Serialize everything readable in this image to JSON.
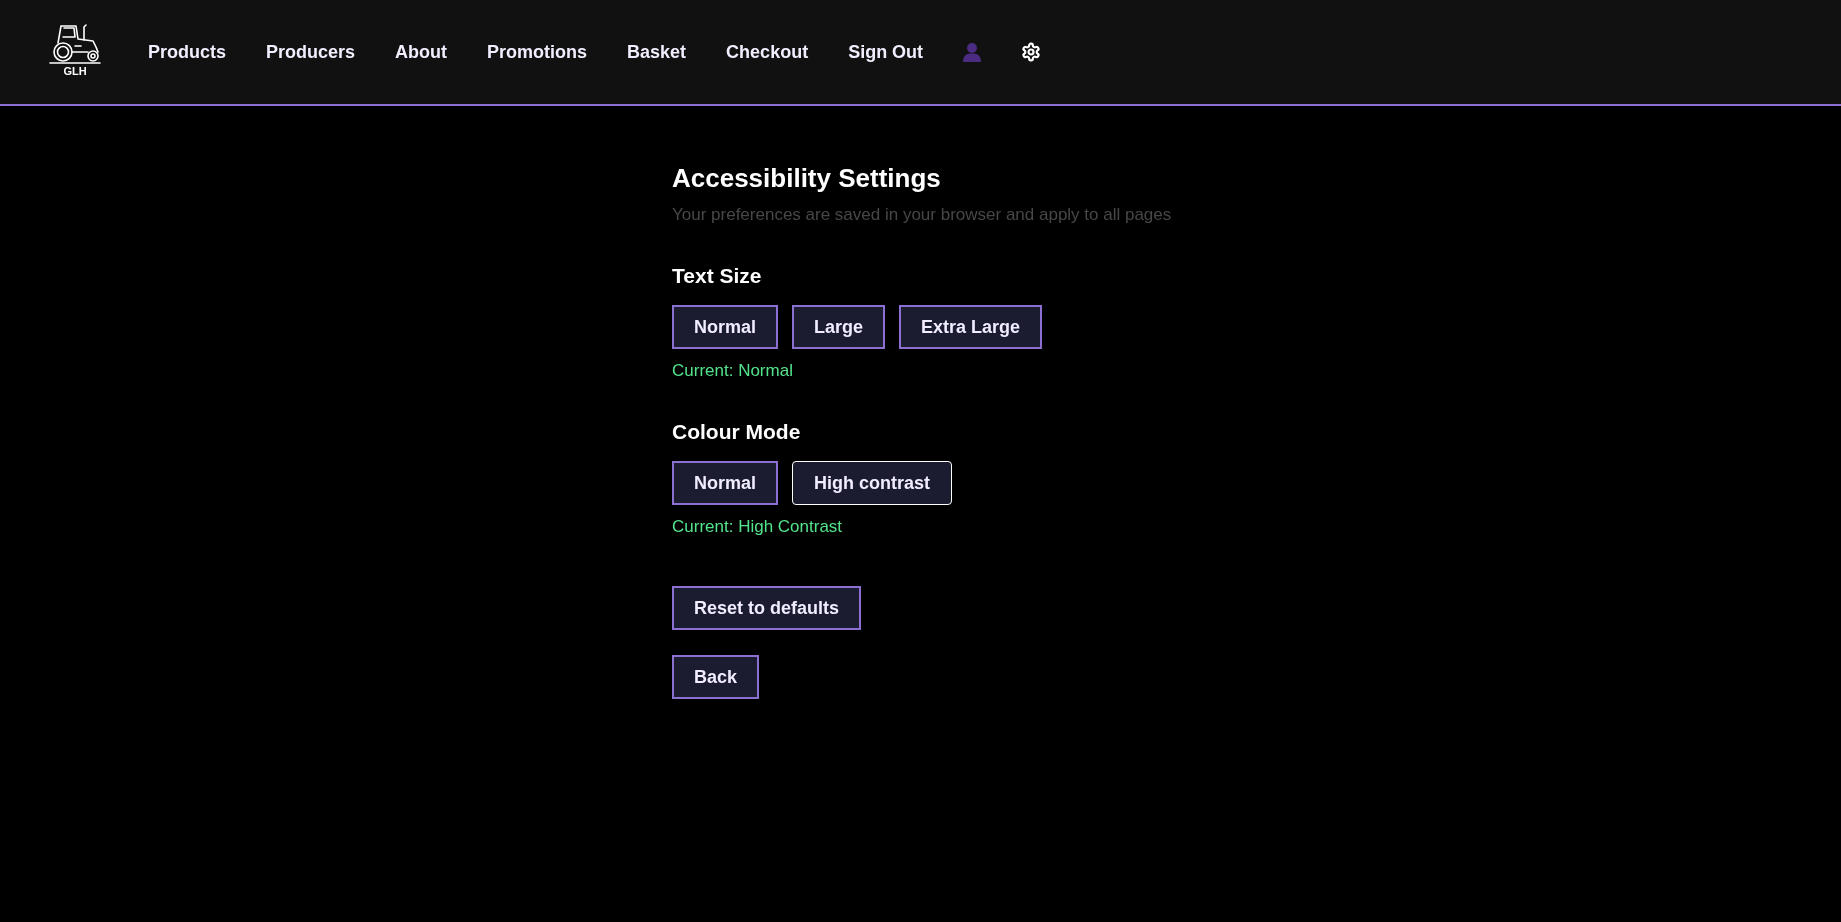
{
  "header": {
    "logo_text": "GLH",
    "nav": [
      {
        "label": "Products"
      },
      {
        "label": "Producers"
      },
      {
        "label": "About"
      },
      {
        "label": "Promotions"
      },
      {
        "label": "Basket"
      },
      {
        "label": "Checkout"
      },
      {
        "label": "Sign Out"
      }
    ]
  },
  "page": {
    "title": "Accessibility Settings",
    "subtitle": "Your preferences are saved in your browser and apply to all pages",
    "sections": [
      {
        "heading": "Text Size",
        "options": [
          {
            "label": "Normal",
            "focused": false
          },
          {
            "label": "Large",
            "focused": false
          },
          {
            "label": "Extra Large",
            "focused": false
          }
        ],
        "current": "Current: Normal"
      },
      {
        "heading": "Colour Mode",
        "options": [
          {
            "label": "Normal",
            "focused": false
          },
          {
            "label": "High contrast",
            "focused": true
          }
        ],
        "current": "Current: High Contrast"
      }
    ],
    "actions": [
      {
        "label": "Reset to defaults"
      },
      {
        "label": "Back"
      }
    ]
  }
}
